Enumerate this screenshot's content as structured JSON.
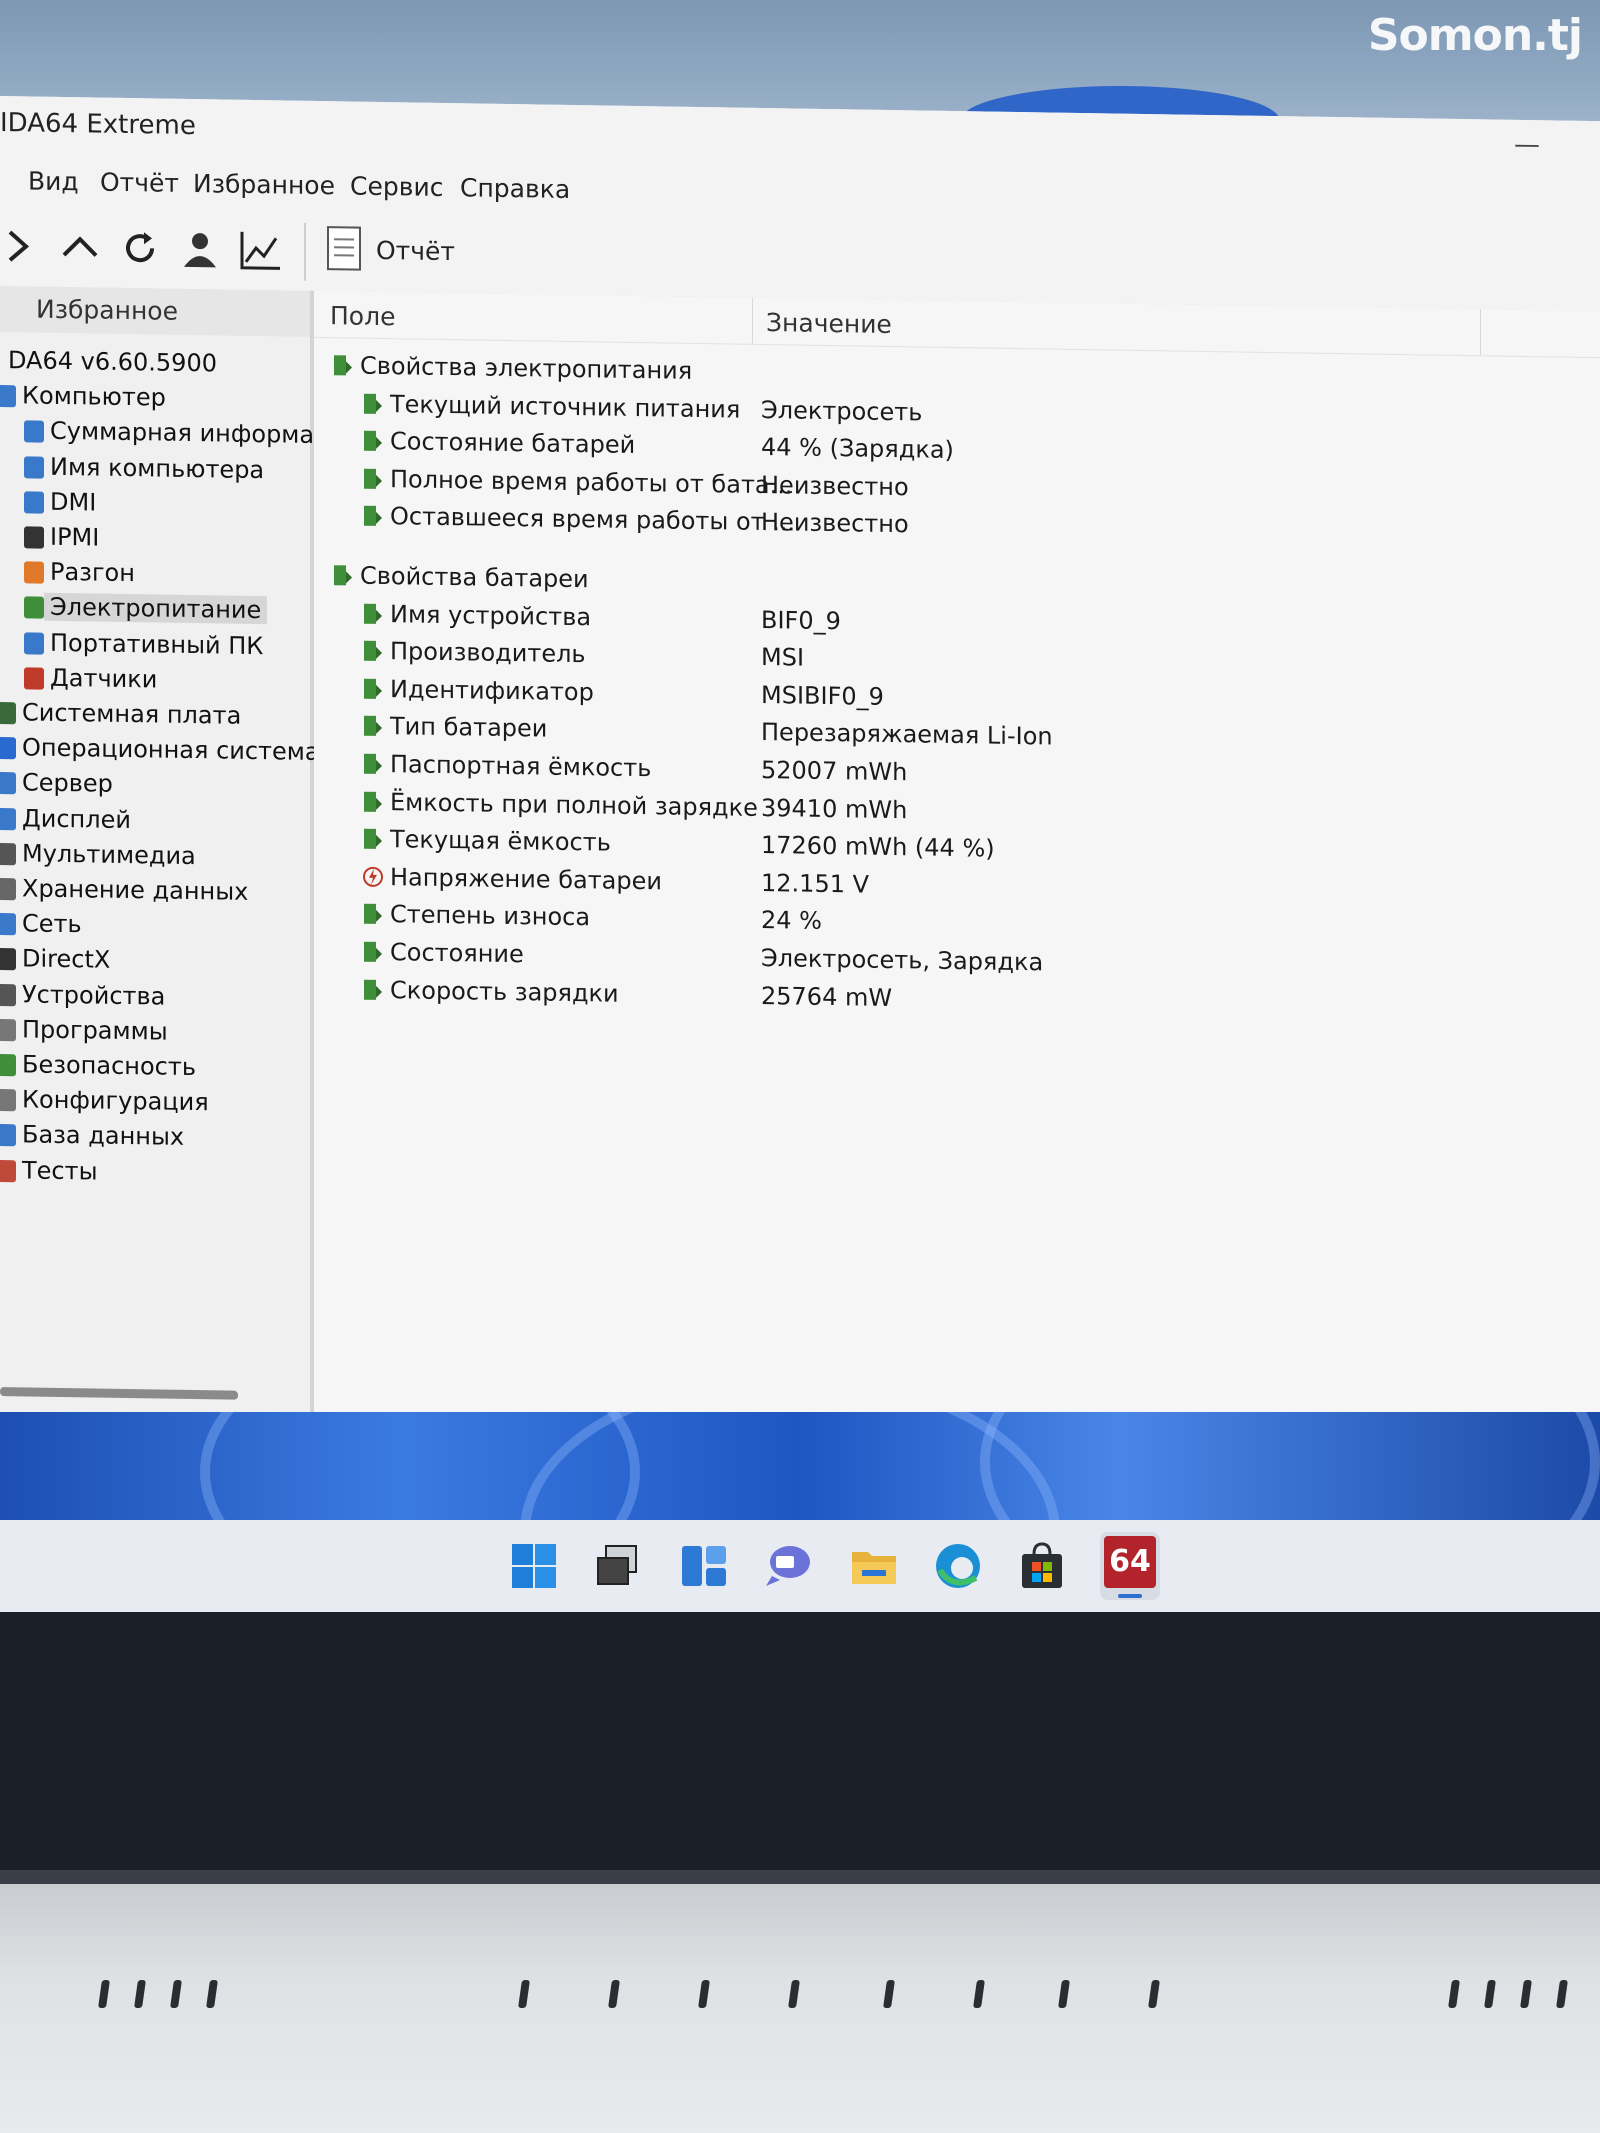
{
  "watermark": "Somon.tj",
  "window": {
    "title": "IDA64 Extreme",
    "minimize": "—"
  },
  "menu": [
    "Вид",
    "Отчёт",
    "Избранное",
    "Сервис",
    "Справка"
  ],
  "toolbar": {
    "buttons": [
      "forward-icon",
      "up-icon",
      "refresh-icon",
      "user-icon",
      "chart-icon"
    ],
    "report_label": "Отчёт"
  },
  "left_panel": {
    "header": "Избранное",
    "items": [
      {
        "label": "DA64 v6.60.5900",
        "level": 0,
        "icon": "aida-icon"
      },
      {
        "label": "Компьютер",
        "level": 0,
        "icon": "computer-icon"
      },
      {
        "label": "Суммарная информац",
        "level": 1,
        "icon": "summary-icon"
      },
      {
        "label": "Имя компьютера",
        "level": 1,
        "icon": "computer-name-icon"
      },
      {
        "label": "DMI",
        "level": 1,
        "icon": "dmi-icon"
      },
      {
        "label": "IPMI",
        "level": 1,
        "icon": "ipmi-icon"
      },
      {
        "label": "Разгон",
        "level": 1,
        "icon": "overclock-icon"
      },
      {
        "label": "Электропитание",
        "level": 1,
        "icon": "power-icon",
        "selected": true
      },
      {
        "label": "Портативный ПК",
        "level": 1,
        "icon": "laptop-icon"
      },
      {
        "label": "Датчики",
        "level": 1,
        "icon": "sensor-icon"
      },
      {
        "label": "Системная плата",
        "level": 0,
        "icon": "motherboard-icon"
      },
      {
        "label": "Операционная система",
        "level": 0,
        "icon": "os-icon"
      },
      {
        "label": "Сервер",
        "level": 0,
        "icon": "server-icon"
      },
      {
        "label": "Дисплей",
        "level": 0,
        "icon": "display-icon"
      },
      {
        "label": "Мультимедиа",
        "level": 0,
        "icon": "multimedia-icon"
      },
      {
        "label": "Хранение данных",
        "level": 0,
        "icon": "storage-icon"
      },
      {
        "label": "Сеть",
        "level": 0,
        "icon": "network-icon"
      },
      {
        "label": "DirectX",
        "level": 0,
        "icon": "directx-icon"
      },
      {
        "label": "Устройства",
        "level": 0,
        "icon": "devices-icon"
      },
      {
        "label": "Программы",
        "level": 0,
        "icon": "programs-icon"
      },
      {
        "label": "Безопасность",
        "level": 0,
        "icon": "security-icon"
      },
      {
        "label": "Конфигурация",
        "level": 0,
        "icon": "config-icon"
      },
      {
        "label": "База данных",
        "level": 0,
        "icon": "database-icon"
      },
      {
        "label": "Тесты",
        "level": 0,
        "icon": "tests-icon"
      }
    ]
  },
  "table": {
    "col_field": "Поле",
    "col_value": "Значение",
    "rows": [
      {
        "field": "Свойства электропитания",
        "value": "",
        "group": true
      },
      {
        "field": "Текущий источник питания",
        "value": "Электросеть"
      },
      {
        "field": "Состояние батарей",
        "value": "44 % (Зарядка)"
      },
      {
        "field": "Полное время работы от бата...",
        "value": "Неизвестно"
      },
      {
        "field": "Оставшееся время работы от ...",
        "value": "Неизвестно"
      },
      {
        "field": "",
        "value": "",
        "spacer": true
      },
      {
        "field": "Свойства батареи",
        "value": "",
        "group": true
      },
      {
        "field": "Имя устройства",
        "value": "BIF0_9"
      },
      {
        "field": "Производитель",
        "value": "MSI"
      },
      {
        "field": "Идентификатор",
        "value": "MSIBIF0_9"
      },
      {
        "field": "Тип батареи",
        "value": "Перезаряжаемая Li-Ion"
      },
      {
        "field": "Паспортная ёмкость",
        "value": "52007 mWh"
      },
      {
        "field": "Ёмкость при полной зарядке",
        "value": "39410 mWh"
      },
      {
        "field": "Текущая ёмкость",
        "value": "17260 mWh  (44 %)"
      },
      {
        "field": "Напряжение батареи",
        "value": "12.151 V",
        "icon": "voltage-icon"
      },
      {
        "field": "Степень износа",
        "value": "24 %"
      },
      {
        "field": "Состояние",
        "value": "Электросеть, Зарядка"
      },
      {
        "field": "Скорость зарядки",
        "value": "25764 mW"
      }
    ]
  },
  "taskbar": {
    "items": [
      "windows-start-icon",
      "task-view-icon",
      "widgets-icon",
      "chat-icon",
      "file-explorer-icon",
      "edge-icon",
      "store-icon",
      "aida64-icon"
    ],
    "aida_label": "64"
  },
  "colors": {
    "battery_green": "#3f8f3a",
    "aida_red": "#b3232c",
    "accent_blue": "#2f6fd0"
  }
}
